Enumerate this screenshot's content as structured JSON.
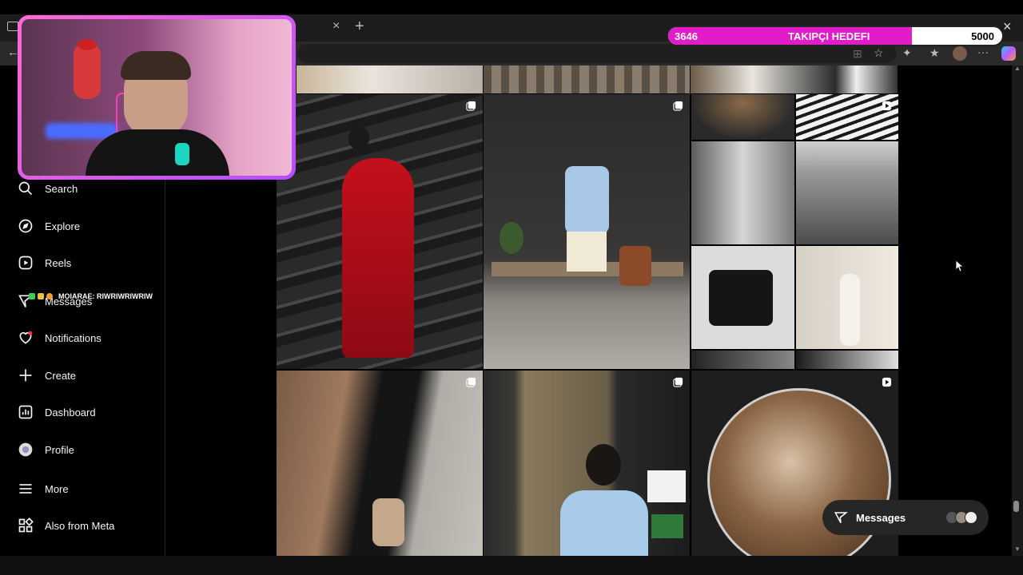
{
  "browser": {
    "close_tab_glyph": "×",
    "new_tab_glyph": "+",
    "window_close_glyph": "×"
  },
  "sidebar": {
    "items": [
      {
        "label": "Search",
        "icon": "search-icon"
      },
      {
        "label": "Explore",
        "icon": "compass-icon"
      },
      {
        "label": "Reels",
        "icon": "reels-icon"
      },
      {
        "label": "Messages",
        "icon": "messenger-icon"
      },
      {
        "label": "Notifications",
        "icon": "heart-icon"
      },
      {
        "label": "Create",
        "icon": "plus-icon"
      },
      {
        "label": "Dashboard",
        "icon": "dashboard-icon"
      },
      {
        "label": "Profile",
        "icon": "avatar"
      },
      {
        "label": "More",
        "icon": "hamburger-icon"
      },
      {
        "label": "Also from Meta",
        "icon": "meta-apps-icon"
      }
    ]
  },
  "overlay": {
    "chat_line": "MOIARAE: RIWRIWRIWRIW"
  },
  "goal": {
    "current": "3646",
    "label": "TAKIPÇI HEDEFI",
    "target": "5000",
    "progress": 0.7292,
    "fill_color": "#e31cc9"
  },
  "messages_pill": {
    "label": "Messages"
  },
  "colors": {
    "accent": "#ff3bd8",
    "notification_dot": "#ff3040",
    "background": "#000000"
  }
}
